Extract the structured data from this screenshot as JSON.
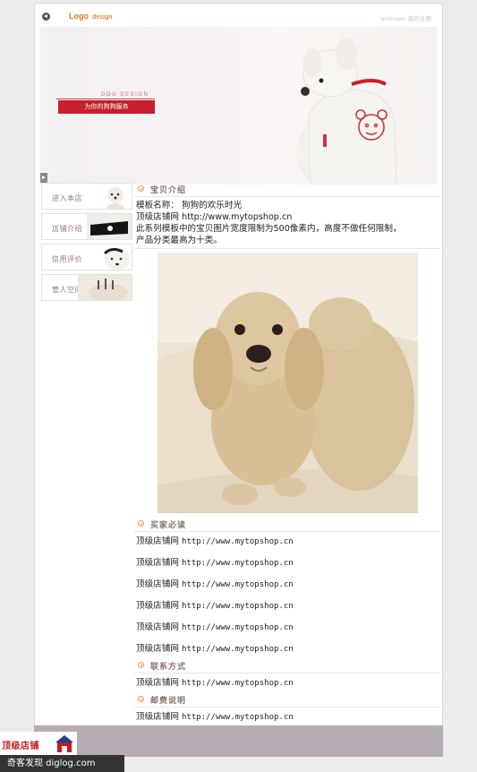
{
  "header": {
    "logo_text": "Logo",
    "logo_sub": "design",
    "welcome": "welcome  我的主题"
  },
  "banner": {
    "tag": "DOG DESIGN",
    "slogan": "为你的狗狗服务"
  },
  "sidebar": {
    "items": [
      {
        "label": "进入本店"
      },
      {
        "label": "店铺介绍"
      },
      {
        "label": "信用评价"
      },
      {
        "label": "管人空间"
      }
    ]
  },
  "intro": {
    "title": "宝贝介绍",
    "lines": [
      "模板名称：  狗狗的欢乐时光",
      "顶级店铺网  http://www.mytopshop.cn",
      "此系列模板中的宝贝图片宽度限制为500像素内，高度不做任何限制，",
      "产品分类最高为十类。"
    ]
  },
  "buyers": {
    "title": "买家必读",
    "rows": [
      {
        "name": "顶级店铺网",
        "url": "http://www.mytopshop.cn"
      },
      {
        "name": "顶级店铺网",
        "url": "http://www.mytopshop.cn"
      },
      {
        "name": "顶级店铺网",
        "url": "http://www.mytopshop.cn"
      },
      {
        "name": "顶级店铺网",
        "url": "http://www.mytopshop.cn"
      },
      {
        "name": "顶级店铺网",
        "url": "http://www.mytopshop.cn"
      },
      {
        "name": "顶级店铺网",
        "url": "http://www.mytopshop.cn"
      }
    ]
  },
  "contact": {
    "title": "联系方式",
    "name": "顶级店铺网",
    "url": "http://www.mytopshop.cn"
  },
  "postage": {
    "title": "邮费说明",
    "name": "顶级店铺网",
    "url": "http://www.mytopshop.cn"
  },
  "watermark": {
    "logo_text": "顶级店铺",
    "site": "奇客发现 diglog.com"
  },
  "colors": {
    "accent": "#e07a1e",
    "slogan_bg": "#c81f2b",
    "footer_bar": "#b5adb3"
  }
}
